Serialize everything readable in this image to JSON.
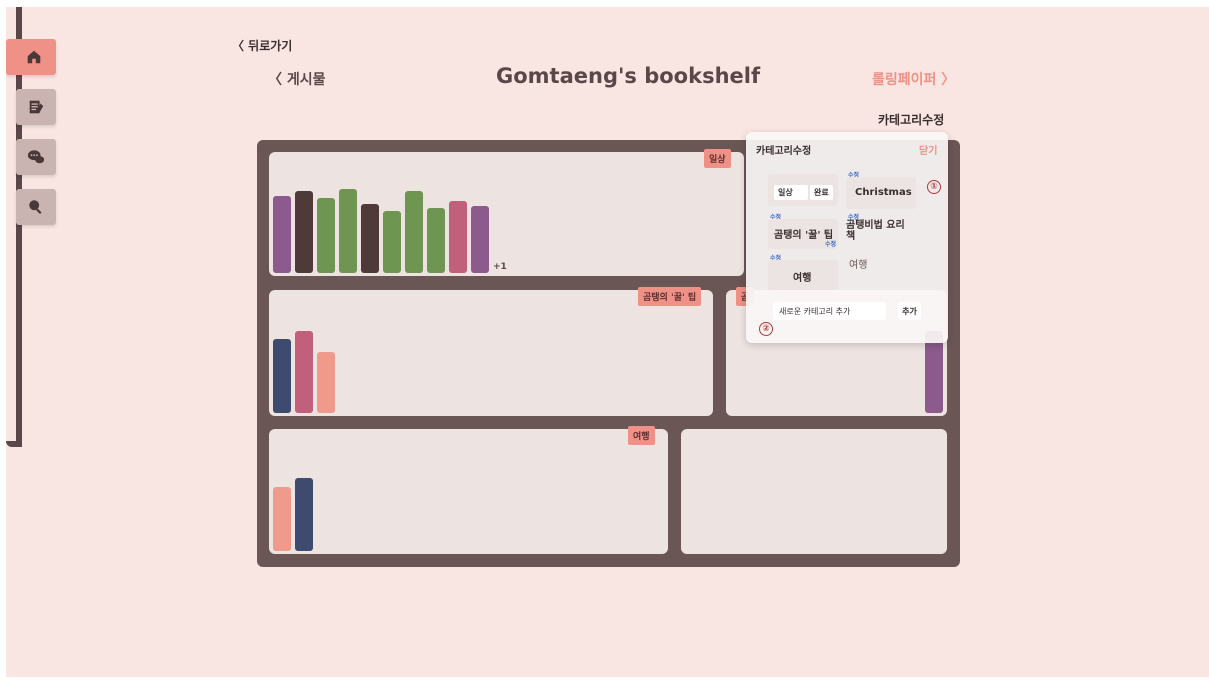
{
  "header": {
    "back_label": "〈 뒤로가기",
    "prev_label": "〈 게시물",
    "title": "Gomtaeng's bookshelf",
    "next_label": "롤링페이퍼 〉",
    "edit_categories_label": "카테고리수정"
  },
  "sidebar": {
    "items": [
      {
        "icon": "home-icon",
        "active": true
      },
      {
        "icon": "posts-icon",
        "active": false
      },
      {
        "icon": "chat-icon",
        "active": false
      },
      {
        "icon": "search-icon",
        "active": false
      }
    ]
  },
  "shelf": {
    "sections": [
      {
        "label": "일상",
        "more": "+1"
      },
      {
        "label": "곰탱의 '꿀' 팁"
      },
      {
        "label": "곰"
      },
      {
        "label": "여행"
      }
    ]
  },
  "popup": {
    "title": "카테고리수정",
    "close_label": "닫기",
    "edit_badge": "수정",
    "categories": [
      {
        "name": "일상",
        "done_label": "완료"
      },
      {
        "name": "Christmas"
      },
      {
        "name": "곰탱의 '꿀' 팁"
      },
      {
        "name": "곰탱비법 요리책"
      },
      {
        "name": "여행"
      },
      {
        "name": "여행"
      }
    ],
    "marker_1": "①",
    "marker_2": "②",
    "new_category_placeholder": "새로운 카테고리 추가",
    "add_label": "추가"
  },
  "colors": {
    "accent": "#ef9186",
    "shelf": "#6b5656",
    "background": "#f9e6e3"
  }
}
